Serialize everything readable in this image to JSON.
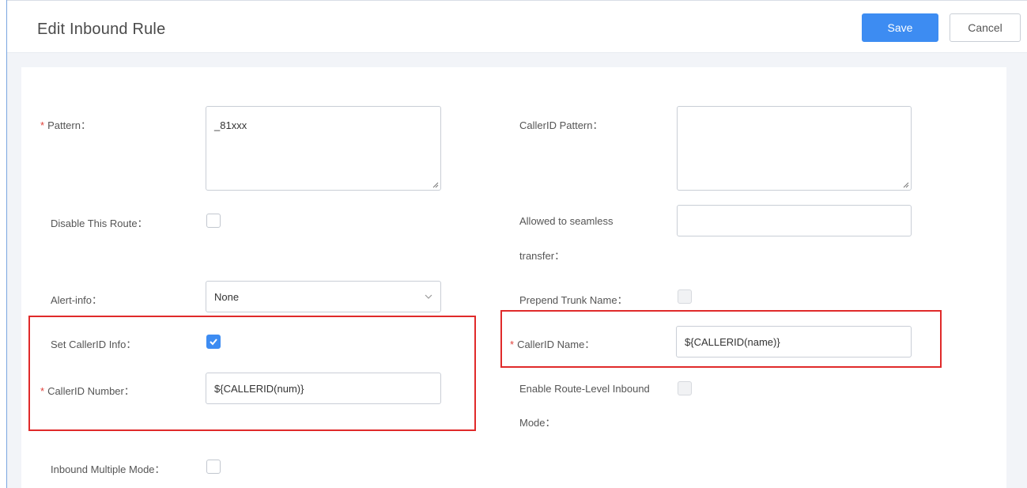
{
  "header": {
    "title": "Edit Inbound Rule",
    "save_label": "Save",
    "cancel_label": "Cancel"
  },
  "form": {
    "pattern": {
      "label": "Pattern：",
      "value": "_81xxx",
      "required": true
    },
    "callerid_pattern": {
      "label": "CallerID Pattern：",
      "value": ""
    },
    "disable_route": {
      "label": "Disable This Route：",
      "checked": false
    },
    "seamless_transfer": {
      "label_line1": "Allowed to seamless",
      "label_line2": "transfer：",
      "value": ""
    },
    "alert_info": {
      "label": "Alert-info：",
      "value": "None"
    },
    "prepend_trunk_name": {
      "label": "Prepend Trunk Name：",
      "checked": false,
      "disabled": true
    },
    "set_callerid_info": {
      "label": "Set CallerID Info：",
      "checked": true
    },
    "callerid_name": {
      "label": "CallerID Name：",
      "value": "${CALLERID(name)}",
      "required": true
    },
    "callerid_number": {
      "label": "CallerID Number：",
      "value": "${CALLERID(num)}",
      "required": true
    },
    "route_level_inbound": {
      "label_line1": "Enable Route-Level Inbound",
      "label_line2": "Mode：",
      "checked": false,
      "disabled": true
    },
    "inbound_multiple_mode": {
      "label": "Inbound Multiple Mode：",
      "checked": false
    }
  },
  "icons": {
    "required_marker": "*",
    "select_chevron": "chevron-down-icon",
    "checkmark": "check-icon"
  },
  "colors": {
    "primary": "#3d8cf2",
    "required": "#e0413a",
    "highlight_box": "#e02a2a"
  }
}
